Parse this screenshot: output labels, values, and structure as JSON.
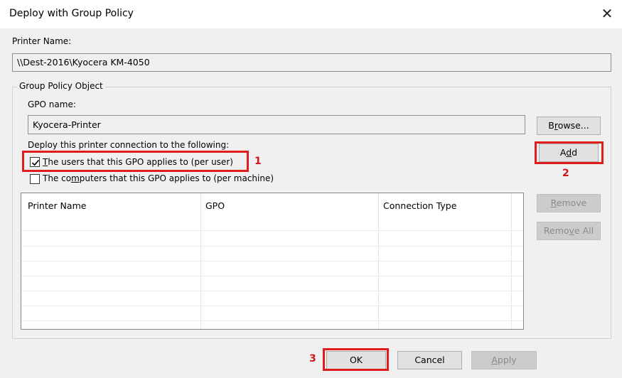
{
  "window": {
    "title": "Deploy with Group Policy"
  },
  "printer": {
    "label": "Printer Name:",
    "value": "\\\\Dest-2016\\Kyocera KM-4050"
  },
  "group": {
    "legend": "Group Policy Object",
    "gpo_label": "GPO name:",
    "gpo_value": "Kyocera-Printer",
    "browse_prefix": "B",
    "browse_ul": "r",
    "browse_suffix": "owse...",
    "deploy_label": "Deploy this printer connection to the following:",
    "per_user": {
      "ul": "T",
      "rest": "he users that this GPO applies to (per user)",
      "checked": true
    },
    "per_machine": {
      "pre": "The co",
      "ul": "m",
      "rest": "puters that this GPO applies to (per machine)",
      "checked": false
    }
  },
  "buttons": {
    "add_pre": "A",
    "add_ul": "d",
    "add_post": "d",
    "remove_ul": "R",
    "remove_rest": "emove",
    "remove_all_pre": "Remo",
    "remove_all_ul": "v",
    "remove_all_post": "e All",
    "ok": "OK",
    "cancel": "Cancel",
    "apply_ul": "A",
    "apply_rest": "pply"
  },
  "table": {
    "columns": [
      "Printer Name",
      "GPO",
      "Connection Type"
    ],
    "rows": []
  },
  "annotations": {
    "one": "1",
    "two": "2",
    "three": "3"
  },
  "colors": {
    "highlight": "#e01c1c",
    "annotation_text": "#d2151b"
  }
}
